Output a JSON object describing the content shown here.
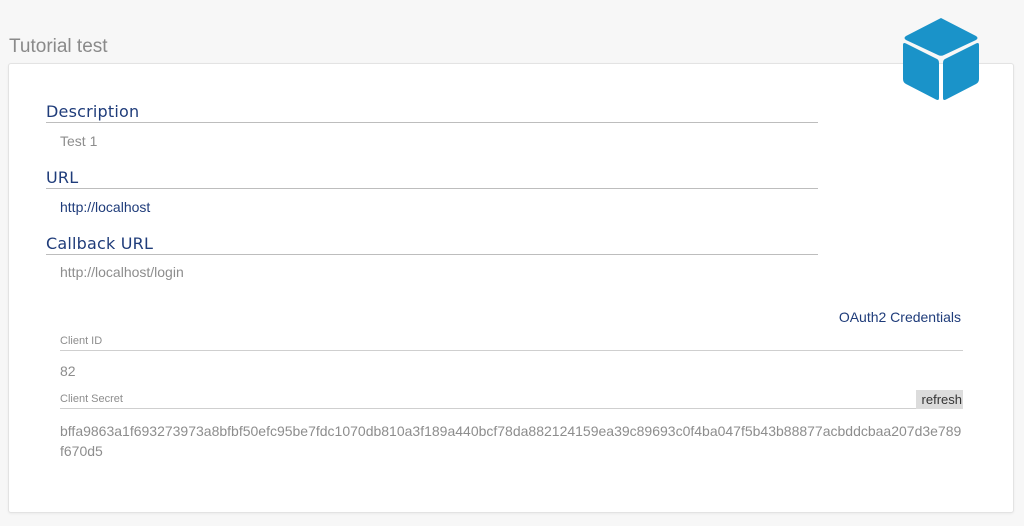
{
  "app": {
    "title": "Tutorial test",
    "logo_icon": "cube-icon",
    "logo_color": "#1a93c9"
  },
  "fields": {
    "description": {
      "label": "Description",
      "value": "Test 1"
    },
    "url": {
      "label": "URL",
      "value": "http://localhost"
    },
    "callback_url": {
      "label": "Callback URL",
      "value": "http://localhost/login"
    }
  },
  "credentials": {
    "heading": "OAuth2 Credentials",
    "client_id_label": "Client ID",
    "client_id_value": "82",
    "client_secret_label": "Client Secret",
    "refresh_label": "refresh",
    "client_secret_value": "bffa9863a1f693273973a8bfbf50efc95be7fdc1070db810a3f189a440bcf78da882124159ea39c89693c0f4ba047f5b43b88877acbddcbaa207d3e789f670d5"
  },
  "colors": {
    "accent": "#1f3c7a",
    "muted_text": "#8d8d8d",
    "logo": "#1a93c9"
  }
}
